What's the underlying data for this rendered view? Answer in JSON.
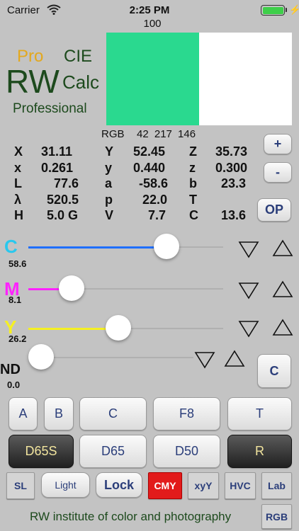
{
  "status": {
    "carrier": "Carrier",
    "time": "2:25 PM"
  },
  "logo": {
    "pro": "Pro",
    "cie": "CIE",
    "rw": "RW",
    "calc": "Calc",
    "professional": "Professional"
  },
  "swatch": {
    "top_value": "100",
    "color": "#2ad98f",
    "rgb_label": "RGB",
    "rgb_values": "42 217 146"
  },
  "grid": [
    [
      "X",
      "31.11",
      "Y",
      "52.45",
      "Z",
      "35.73"
    ],
    [
      "x",
      "0.261",
      "y",
      "0.440",
      "z",
      "0.300"
    ],
    [
      "L",
      "77.6",
      "a",
      "-58.6",
      "b",
      "23.3"
    ],
    [
      "λ",
      "520.5",
      "p",
      "22.0",
      "T",
      ""
    ],
    [
      "H",
      "5.0 G",
      "V",
      "7.7",
      "C",
      "13.6"
    ]
  ],
  "side_buttons": {
    "plus": "+",
    "minus": "-",
    "op": "OP",
    "c": "C"
  },
  "sliders": {
    "c": {
      "label": "C",
      "value": "58.6",
      "color": "#29c8ee",
      "fill_color": "#1f6fff",
      "fraction": 0.71
    },
    "m": {
      "label": "M",
      "value": "8.1",
      "color": "#ff22ff",
      "fill_color": "#ff22ff",
      "fraction": 0.22
    },
    "y": {
      "label": "Y",
      "value": "26.2",
      "color": "#f5f022",
      "fill_color": "#f5f022",
      "fraction": 0.46
    },
    "nd": {
      "label": "ND",
      "value": "0.0",
      "color": "#111111",
      "fill_color": "#b0b0b0",
      "fraction": 0.0
    }
  },
  "row1": {
    "a": "A",
    "b": "B",
    "c": "C",
    "f8": "F8",
    "t": "T"
  },
  "row2": {
    "d65s": "D65S",
    "d65": "D65",
    "d50": "D50",
    "r": "R"
  },
  "row3": {
    "sl": "SL",
    "light": "Light",
    "lock": "Lock",
    "cmy": "CMY",
    "xyy": "xyY",
    "hvc": "HVC",
    "lab": "Lab"
  },
  "footer": {
    "text": "RW institute of color and photography",
    "rgb_button": "RGB"
  }
}
